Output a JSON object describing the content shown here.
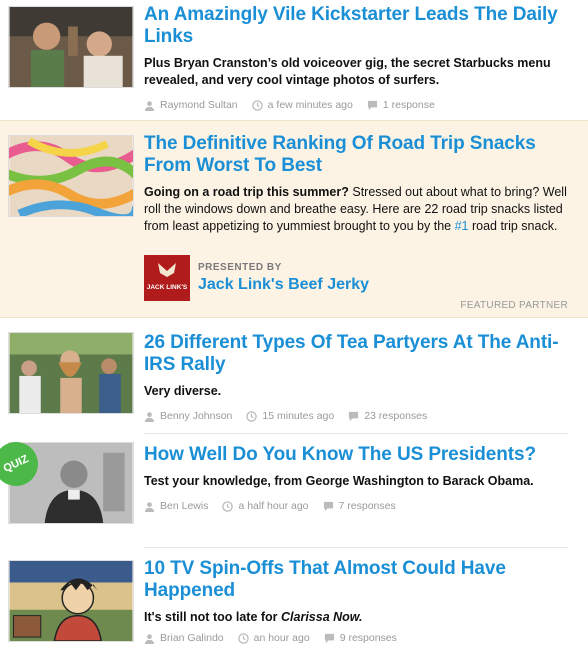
{
  "articles": [
    {
      "title": "An Amazingly Vile Kickstarter Leads The Daily Links",
      "desc": "Plus Bryan Cranston’s old voiceover gig, the secret Starbucks menu revealed, and very cool vintage photos of surfers.",
      "author": "Raymond Sultan",
      "time": "a few minutes ago",
      "responses": "1 response"
    },
    {
      "title": "The Definitive Ranking Of Road Trip Snacks From Worst To Best",
      "desc_bold": "Going on a road trip this summer?",
      "desc_rest": " Stressed out about what to bring? Well roll the windows down and breathe easy. Here are 22 road trip snacks listed from least appetizing to yummiest brought to you by the ",
      "desc_link": "#1",
      "desc_end": " road trip snack.",
      "presented_label": "PRESENTED BY",
      "sponsor": "Jack Link's Beef Jerky",
      "sponsor_logo_text": "JACK LINK'S",
      "featured_label": "FEATURED PARTNER"
    },
    {
      "title": "26 Different Types Of Tea Partyers At The Anti-IRS Rally",
      "desc": "Very diverse.",
      "author": "Benny Johnson",
      "time": "15 minutes ago",
      "responses": "23 responses"
    },
    {
      "title": "How Well Do You Know The US Presidents?",
      "desc": "Test your knowledge, from George Washington to Barack Obama.",
      "author": "Ben Lewis",
      "time": "a half hour ago",
      "responses": "7 responses",
      "badge": "QUIZ"
    },
    {
      "title": "10 TV Spin-Offs That Almost Could Have Happened",
      "desc_prefix": "It's still not too late for ",
      "desc_italic": "Clarissa Now.",
      "author": "Brian Galindo",
      "time": "an hour ago",
      "responses": "9 responses"
    }
  ],
  "colors": {
    "link": "#1a8fd6",
    "featured_bg": "#fdf3e4",
    "meta": "#9a9a9a",
    "quiz_badge": "#4cb848"
  }
}
